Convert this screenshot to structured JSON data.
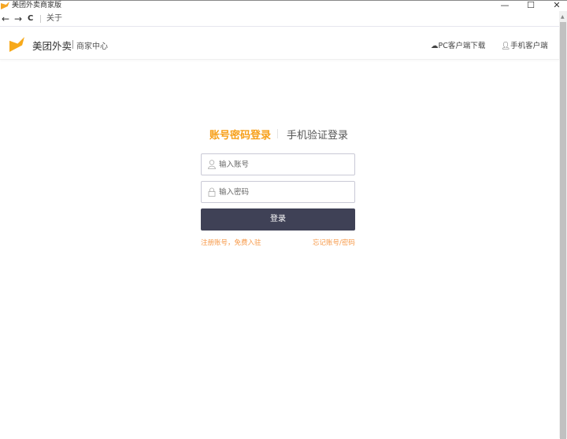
{
  "window": {
    "title": "美团外卖商家版",
    "minimize": "—",
    "maximize": "☐",
    "close": "✕"
  },
  "nav": {
    "back": "←",
    "forward": "→",
    "reload": "C",
    "about": "关于"
  },
  "header": {
    "brand": "美团外卖",
    "subtitle": "商家中心",
    "pc_download": "PC客户端下载",
    "mobile_client": "手机客户端"
  },
  "login": {
    "tab_active": "账号密码登录",
    "tab_other": "手机验证登录",
    "account_placeholder": "输入账号",
    "password_placeholder": "输入密码",
    "submit": "登录",
    "register": "注册账号，免费入驻",
    "forgot": "忘记账号/密码"
  },
  "colors": {
    "accent": "#f7a01a",
    "button": "#3f4156",
    "link": "#f79a4a"
  }
}
